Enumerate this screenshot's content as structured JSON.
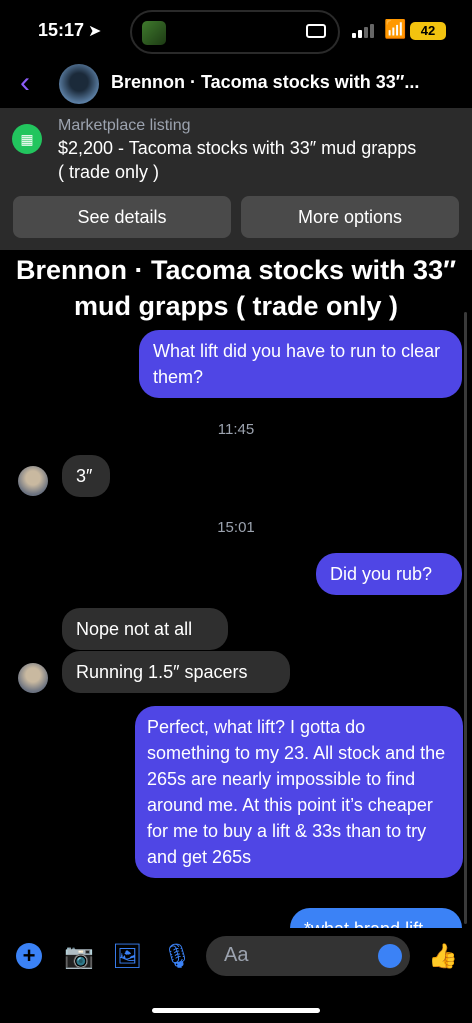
{
  "status": {
    "time": "15:17",
    "battery": "42"
  },
  "header": {
    "title": "Brennon · Tacoma stocks with 33″..."
  },
  "listing": {
    "label": "Marketplace listing",
    "text": "$2,200 - Tacoma stocks with 33″ mud grapps ( trade only )",
    "see_details": "See details",
    "more_options": "More options"
  },
  "conversation_title": "Brennon · Tacoma stocks with 33″ mud grapps ( trade only )",
  "messages": [
    {
      "text": "What lift did you have to run to clear them?"
    },
    {
      "text": "11:45"
    },
    {
      "text": "3″"
    },
    {
      "text": "15:01"
    },
    {
      "text": "Did you rub?"
    },
    {
      "text": "Nope not at all"
    },
    {
      "text": "Running 1.5″ spacers"
    },
    {
      "text": "Perfect, what lift? I gotta do something to my 23. All stock and the 265s are nearly impossible to find around me. At this point it’s cheaper for me to buy a lift & 33s than to try and get 265s"
    },
    {
      "text": "*what brand lift"
    }
  ],
  "composer": {
    "placeholder": "Aa"
  },
  "icons": [
    "location-arrow-icon",
    "cellular-signal-icon",
    "wifi-icon",
    "battery-icon",
    "back-chevron-icon",
    "marketplace-icon",
    "plus-icon",
    "camera-icon",
    "photo-icon",
    "microphone-icon",
    "emoji-icon",
    "like-thumb-icon"
  ],
  "colors": {
    "accent": "#4f46e5",
    "incoming": "#2f2f2f",
    "marketplace": "#22c55e",
    "header_back": "#8b5cf6"
  }
}
